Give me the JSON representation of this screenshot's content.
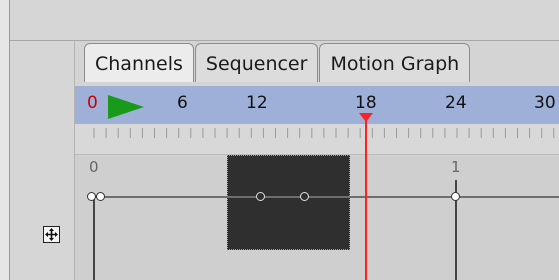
{
  "tabs": [
    {
      "label": "Channels",
      "active": true
    },
    {
      "label": "Sequencer",
      "active": false
    },
    {
      "label": "Motion Graph",
      "active": false
    }
  ],
  "ruler": {
    "start_frame": "0",
    "tick_labels": [
      "6",
      "12",
      "18",
      "24",
      "30"
    ],
    "current_frame": 18
  },
  "track": {
    "keyframe_labels": [
      "0",
      "1"
    ]
  },
  "colors": {
    "ruler_bar": "#9fb0d8",
    "play": "#1a9a1a",
    "playhead": "#ff2222",
    "start_frame": "#cc0000",
    "block": "#2f2f2f"
  },
  "icons": {
    "play": "play-icon",
    "move": "move-icon"
  }
}
